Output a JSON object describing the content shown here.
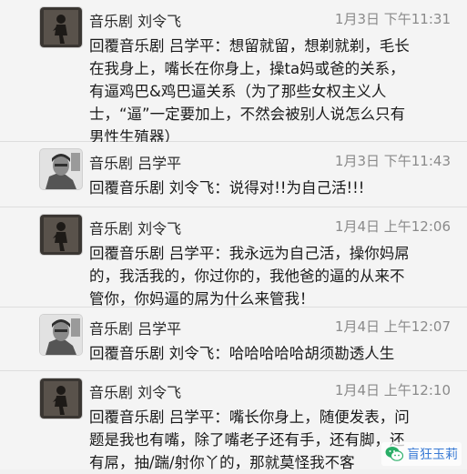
{
  "messages": [
    {
      "author": "音乐剧 刘令飞",
      "avatar": "dark-silhouette-avatar",
      "time": "1月3日 下午11:31",
      "text": "回覆音乐剧 吕学平：想留就留，想剃就剃，毛长\n在我身上，嘴长在你身上，操ta妈或爸的关系，\n有逼鸡巴&鸡巴逼关系（为了那些女权主义人\n士，“逼”一定要加上，不然会被别人说怎么只有\n男性生殖器）"
    },
    {
      "author": "音乐剧 吕学平",
      "avatar": "grayscale-portrait-avatar",
      "time": "1月3日 下午11:43",
      "text": "回覆音乐剧 刘令飞：说得对!!为自己活!!!"
    },
    {
      "author": "音乐剧 刘令飞",
      "avatar": "dark-silhouette-avatar",
      "time": "1月4日 上午12:06",
      "text": "回覆音乐剧 吕学平：我永远为自己活，操你妈屌\n的，我活我的，你过你的，我他爸的逼的从来不\n管你，你妈逼的屌为什么来管我！"
    },
    {
      "author": "音乐剧 吕学平",
      "avatar": "grayscale-portrait-avatar",
      "time": "1月4日 上午12:07",
      "text": "回覆音乐剧 刘令飞：哈哈哈哈哈胡须勘透人生"
    },
    {
      "author": "音乐剧 刘令飞",
      "avatar": "dark-silhouette-avatar",
      "time": "1月4日 上午12:10",
      "text": "回覆音乐剧 吕学平：嘴长你身上，随便发表，问\n题是我也有嘴，除了嘴老子还有手，还有脚，还\n有屌，抽/踹/射你丫的，那就莫怪我不客"
    }
  ],
  "watermark": {
    "text": "盲狂玉莉",
    "icon": "wechat-logo-icon"
  }
}
